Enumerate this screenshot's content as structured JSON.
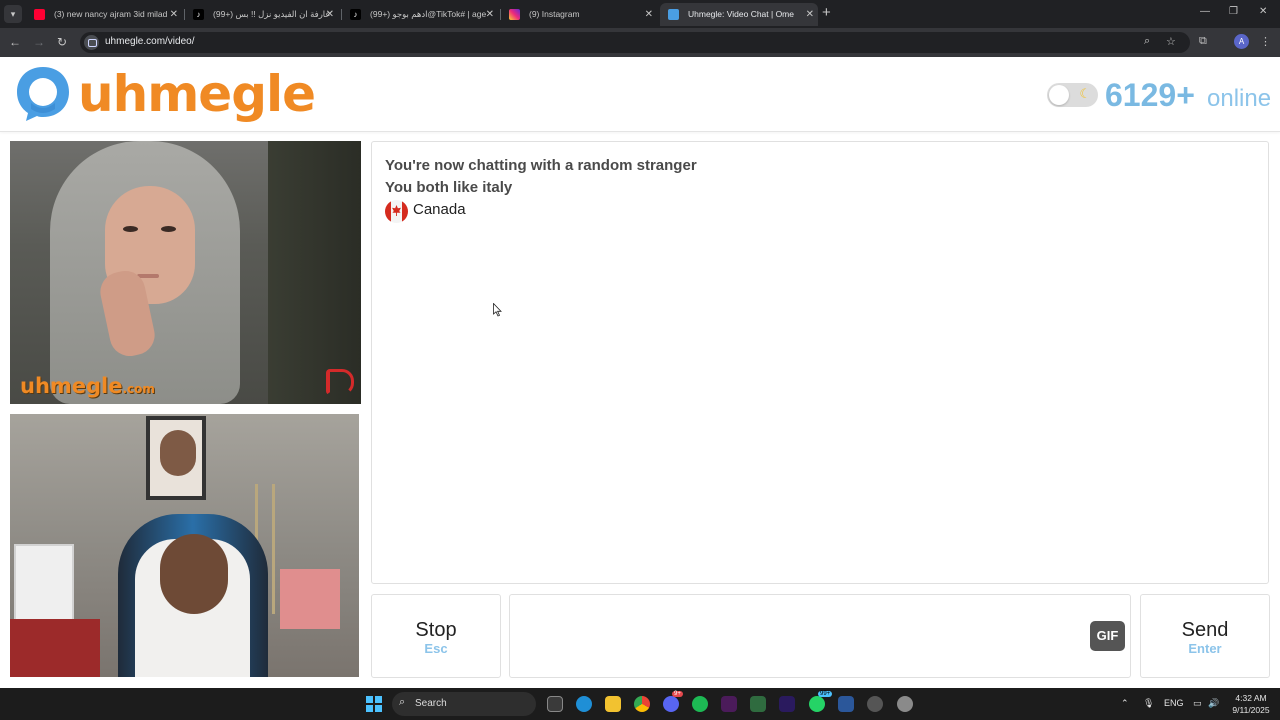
{
  "browser": {
    "tabs": [
      {
        "title": "(3) new nancy ajram 3id milad",
        "icon": "youtube-icon",
        "color": "#ff0033",
        "active": false
      },
      {
        "title": "عارفة ان الفيديو نزل !! بس (+99)",
        "icon": "tiktok-icon",
        "color": "#ffffff",
        "active": false
      },
      {
        "title": "ادهم بوجو (+99)@TikTok# | age",
        "icon": "tiktok-icon",
        "color": "#ffffff",
        "active": false
      },
      {
        "title": "(9) Instagram",
        "icon": "instagram-icon",
        "color": "#e1306c",
        "active": false
      },
      {
        "title": "Uhmegle: Video Chat | Ome",
        "icon": "uhmegle-icon",
        "color": "#4a9ee3",
        "active": true
      }
    ],
    "url": "uhmegle.com/video/",
    "profile_initial": "A"
  },
  "header": {
    "logo_text": "uhmegle",
    "online_count": "6129+",
    "online_label": "online",
    "dark_mode": false
  },
  "videos": {
    "stranger_watermark": "uhmegle",
    "stranger_watermark_suffix": ".com"
  },
  "chat": {
    "status_line": "You're now chatting with a random stranger",
    "interest_line": "You both like italy",
    "country": "Canada"
  },
  "controls": {
    "stop_label": "Stop",
    "stop_key": "Esc",
    "message_value": "",
    "gif_label": "GIF",
    "send_label": "Send",
    "send_key": "Enter"
  },
  "taskbar": {
    "search_placeholder": "Search",
    "discord_badge": "9+",
    "whatsapp_badge": "99+",
    "language": "ENG",
    "time": "4:32 AM",
    "date": "9/11/2025"
  },
  "colors": {
    "brand_orange": "#f08a24",
    "brand_blue": "#4a9ee3",
    "online_blue": "#7ab9e2"
  }
}
